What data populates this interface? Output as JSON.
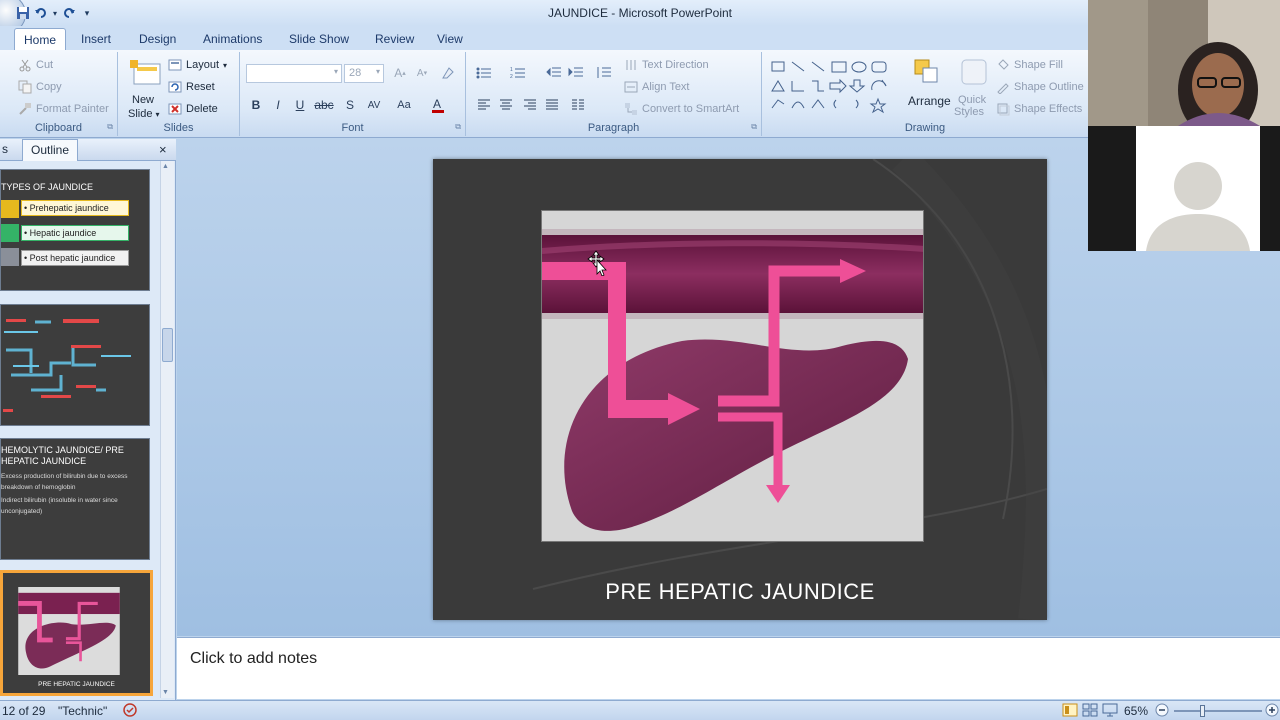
{
  "window": {
    "title": "JAUNDICE - Microsoft PowerPoint"
  },
  "tabs": [
    "Home",
    "Insert",
    "Design",
    "Animations",
    "Slide Show",
    "Review",
    "View"
  ],
  "active_tab": "Home",
  "ribbon": {
    "clipboard": {
      "label": "Clipboard",
      "cut": "Cut",
      "copy": "Copy",
      "format_painter": "Format Painter"
    },
    "slides": {
      "label": "Slides",
      "new_slide": "New",
      "new_slide_2": "Slide",
      "layout": "Layout",
      "reset": "Reset",
      "delete": "Delete"
    },
    "font": {
      "label": "Font",
      "font_name": "",
      "font_size": "28"
    },
    "paragraph": {
      "label": "Paragraph",
      "text_direction": "Text Direction",
      "align_text": "Align Text",
      "convert_smartart": "Convert to SmartArt"
    },
    "drawing": {
      "label": "Drawing",
      "arrange": "Arrange",
      "quick_styles": "Quick",
      "quick_styles_2": "Styles",
      "shape_fill": "Shape Fill",
      "shape_outline": "Shape Outline",
      "shape_effects": "Shape Effects"
    }
  },
  "left_panel": {
    "tab_slides": "s",
    "tab_outline": "Outline",
    "close": "×",
    "thumbs": [
      {
        "title": "TYPES OF JAUNDICE",
        "items": [
          "• Prehepatic jaundice",
          "• Hepatic jaundice",
          "• Post hepatic jaundice"
        ]
      },
      {
        "title": ""
      },
      {
        "title": "HEMOLYTIC JAUNDICE/ PRE HEPATIC JAUNDICE",
        "lines": [
          "Excess production of bilirubin due to excess breakdown of hemoglobin",
          "Indirect bilirubin (insoluble in water since unconjugated)"
        ]
      },
      {
        "title": "PRE HEPATIC JAUNDICE"
      }
    ]
  },
  "slide": {
    "title": "PRE HEPATIC JAUNDICE"
  },
  "notes": {
    "placeholder": "Click to add notes"
  },
  "statusbar": {
    "slide_info": "12 of 29",
    "theme": "\"Technic\"",
    "zoom": "65%"
  },
  "colors": {
    "accent_pink": "#e8559a",
    "vessel": "#7a2150",
    "liver": "#7b2c57",
    "slide_bg": "#3a3a3a",
    "selected_thumb": "#f6a53a"
  }
}
